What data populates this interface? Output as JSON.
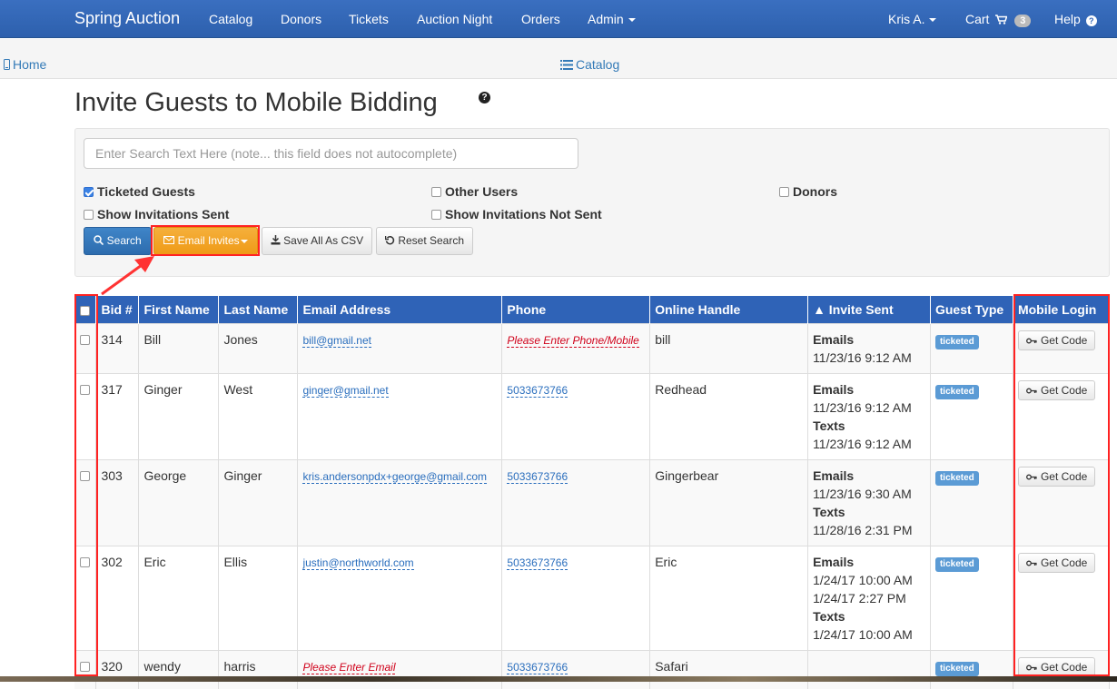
{
  "navbar": {
    "brand": "Spring Auction",
    "items": [
      "Catalog",
      "Donors",
      "Tickets",
      "Auction Night",
      "Orders",
      "Admin"
    ],
    "user": "Kris A.",
    "cart_label": "Cart",
    "cart_count": "3",
    "help_label": "Help"
  },
  "subbar": {
    "home": "Home",
    "catalog": "Catalog"
  },
  "page": {
    "title": "Invite Guests to Mobile Bidding"
  },
  "search": {
    "placeholder": "Enter Search Text Here (note... this field does not autocomplete)",
    "filters": {
      "ticketed": {
        "label": "Ticketed Guests",
        "checked": true
      },
      "other_users": {
        "label": "Other Users",
        "checked": false
      },
      "donors": {
        "label": "Donors",
        "checked": false
      },
      "inv_sent": {
        "label": "Show Invitations Sent",
        "checked": false
      },
      "inv_not_sent": {
        "label": "Show Invitations Not Sent",
        "checked": false
      }
    },
    "buttons": {
      "search": "Search",
      "email_invites": "Email Invites",
      "save_csv": "Save All As CSV",
      "reset": "Reset Search"
    }
  },
  "table": {
    "headers": [
      "Bid #",
      "First Name",
      "Last Name",
      "Email Address",
      "Phone",
      "Online Handle",
      "▲ Invite Sent",
      "Guest Type",
      "Mobile Login"
    ],
    "badge": "ticketed",
    "code_button": "Get Code",
    "rows": [
      {
        "bid": "314",
        "first": "Bill",
        "last": "Jones",
        "email": "bill@gmail.net",
        "email_missing": false,
        "phone": "Please Enter Phone/Mobile",
        "phone_missing": true,
        "handle": "bill",
        "invite": [
          "Emails",
          "11/23/16 9:12 AM"
        ]
      },
      {
        "bid": "317",
        "first": "Ginger",
        "last": "West",
        "email": "ginger@gmail.net",
        "email_missing": false,
        "phone": "5033673766",
        "phone_missing": false,
        "handle": "Redhead",
        "invite": [
          "Emails",
          "11/23/16 9:12 AM",
          "Texts",
          "11/23/16 9:12 AM"
        ]
      },
      {
        "bid": "303",
        "first": "George",
        "last": "Ginger",
        "email": "kris.andersonpdx+george@gmail.com",
        "email_missing": false,
        "phone": "5033673766",
        "phone_missing": false,
        "handle": "Gingerbear",
        "invite": [
          "Emails",
          "11/23/16 9:30 AM",
          "Texts",
          "11/28/16 2:31 PM"
        ]
      },
      {
        "bid": "302",
        "first": "Eric",
        "last": "Ellis",
        "email": "justin@northworld.com",
        "email_missing": false,
        "phone": "5033673766",
        "phone_missing": false,
        "handle": "Eric",
        "invite": [
          "Emails",
          "1/24/17 10:00 AM",
          "1/24/17 2:27 PM",
          "Texts",
          "1/24/17 10:00 AM"
        ]
      },
      {
        "bid": "320",
        "first": "wendy",
        "last": "harris",
        "email": "Please Enter Email",
        "email_missing": true,
        "phone": "5033673766",
        "phone_missing": false,
        "handle": "Safari",
        "invite": []
      }
    ]
  },
  "colors": {
    "navbar": "#2f63b7",
    "accent": "#ef9a16",
    "highlight": "#ff2222"
  }
}
